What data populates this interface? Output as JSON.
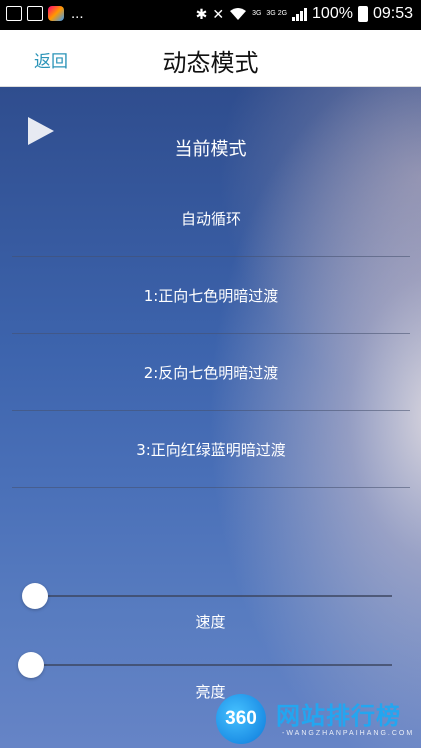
{
  "status_bar": {
    "dots": "...",
    "net_top": "3G",
    "net_bottom": "3G 2G",
    "battery_percent": "100%",
    "time": "09:53",
    "icons": [
      "gallery-icon",
      "paw-app-icon",
      "colorful-app-icon",
      "bluetooth-icon",
      "mute-icon",
      "wifi-icon",
      "signal-icon",
      "battery-icon"
    ]
  },
  "header": {
    "back_label": "返回",
    "title": "动态模式"
  },
  "main": {
    "play_icon": "play-icon",
    "current_mode_label": "当前模式",
    "modes": [
      {
        "label": "自动循环"
      },
      {
        "label": "1:正向七色明暗过渡"
      },
      {
        "label": "2:反向七色明暗过渡"
      },
      {
        "label": "3:正向红绿蓝明暗过渡"
      }
    ],
    "speed": {
      "label": "速度",
      "value": 0
    },
    "brightness": {
      "label": "亮度",
      "value": 0
    }
  },
  "watermark": {
    "logo_text": "360",
    "site_name": "网站排行榜",
    "domain": "-WANGZHANPAIHANG.COM"
  },
  "colors": {
    "accent": "#2b94b8",
    "header_bg": "#ffffff",
    "status_bg": "#000000",
    "watermark_blue": "#23a6f0"
  }
}
